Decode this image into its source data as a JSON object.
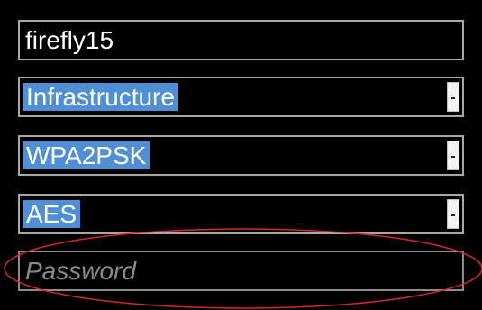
{
  "wifi_form": {
    "ssid_value": "firefly15",
    "network_type": {
      "selected": "Infrastructure"
    },
    "authentication": {
      "selected": "WPA2PSK"
    },
    "encryption": {
      "selected": "AES"
    },
    "password_placeholder": "Password"
  },
  "icons": {
    "dropdown": "chevron-down-icon"
  },
  "colors": {
    "background": "#000000",
    "field_border": "#a8a8a8",
    "selection_highlight": "#4f8fd6",
    "annotation_ellipse": "#d62828"
  }
}
